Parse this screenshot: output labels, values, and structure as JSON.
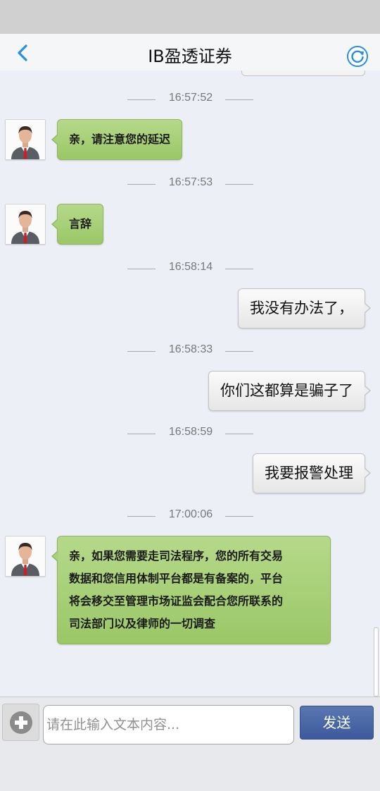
{
  "header": {
    "title": "IB盈透证券",
    "back_icon": "chevron-left-icon",
    "refresh_icon": "refresh-icon",
    "accent_color": "#2a8ee0"
  },
  "messages": [
    {
      "time": "16:57:52",
      "from": "agent",
      "text": "亲，请注意您的延迟"
    },
    {
      "time": "16:57:53",
      "from": "agent",
      "text": "言辞"
    },
    {
      "time": "16:58:14",
      "from": "user",
      "text": "我没有办法了，"
    },
    {
      "time": "16:58:33",
      "from": "user",
      "text": "你们这都算是骗子了"
    },
    {
      "time": "16:58:59",
      "from": "user",
      "text": "我要报警处理"
    },
    {
      "time": "17:00:06",
      "from": "agent",
      "lines": [
        "亲，如果您需要走司法程序，您的所有交易",
        "数据和您信用体制平台都是有备案的，平台",
        "将会移交至管理市场证监会配合您所联系的",
        "司法部门以及律师的一切调查"
      ]
    }
  ],
  "composer": {
    "placeholder": "请在此输入文本内容...",
    "value": "",
    "send_label": "发送",
    "attach_icon": "plus-circle-icon"
  },
  "colors": {
    "agent_bubble": "#a9d07b",
    "user_bubble": "#eeeeee",
    "send_button": "#4a68a6",
    "background": "#ecf0f6"
  }
}
